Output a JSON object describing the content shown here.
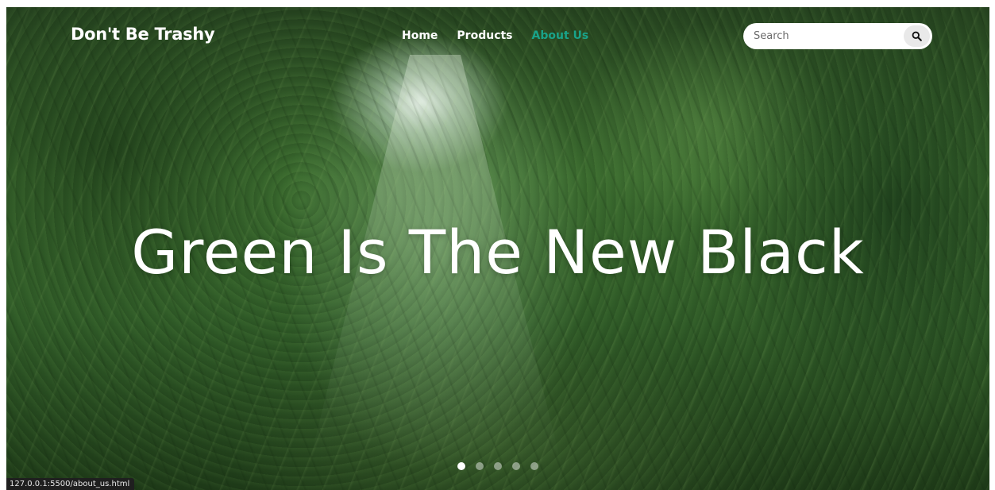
{
  "header": {
    "brand": "Don't Be Trashy",
    "nav": [
      {
        "label": "Home",
        "active": false
      },
      {
        "label": "Products",
        "active": false
      },
      {
        "label": "About Us",
        "active": true
      }
    ],
    "search": {
      "placeholder": "Search",
      "icon": "search-icon"
    }
  },
  "hero": {
    "title": "Green Is The New Black",
    "background": "rainforest-photo",
    "slides": {
      "count": 5,
      "active_index": 0
    }
  },
  "status_bar": {
    "url": "127.0.0.1:5500/about_us.html"
  },
  "colors": {
    "active_nav": "#19a38a",
    "text": "#ffffff"
  }
}
